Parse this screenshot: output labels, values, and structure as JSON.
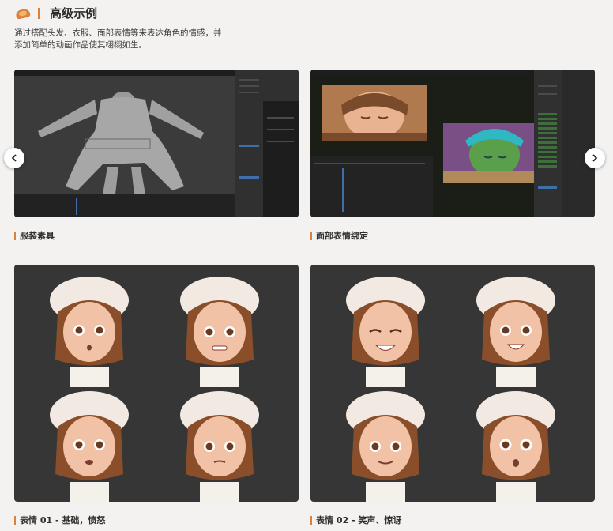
{
  "section": {
    "title": "高级示例",
    "description_line1": "通过搭配头发、衣服、面部表情等来表达角色的情感，并",
    "description_line2": "添加简单的动画作品使其栩栩如生。"
  },
  "cards": [
    {
      "caption": "服装素具"
    },
    {
      "caption": "面部表情绑定"
    },
    {
      "caption": "表情 01 - 基础，愤怒"
    },
    {
      "caption": "表情 02 - 笑声、惊讶"
    }
  ],
  "nav": {
    "prev_icon": "chevron-left-icon",
    "next_icon": "chevron-right-icon"
  },
  "colors": {
    "accent": "#d9813e",
    "background": "#f3f2f0",
    "card_dark": "#363636"
  }
}
